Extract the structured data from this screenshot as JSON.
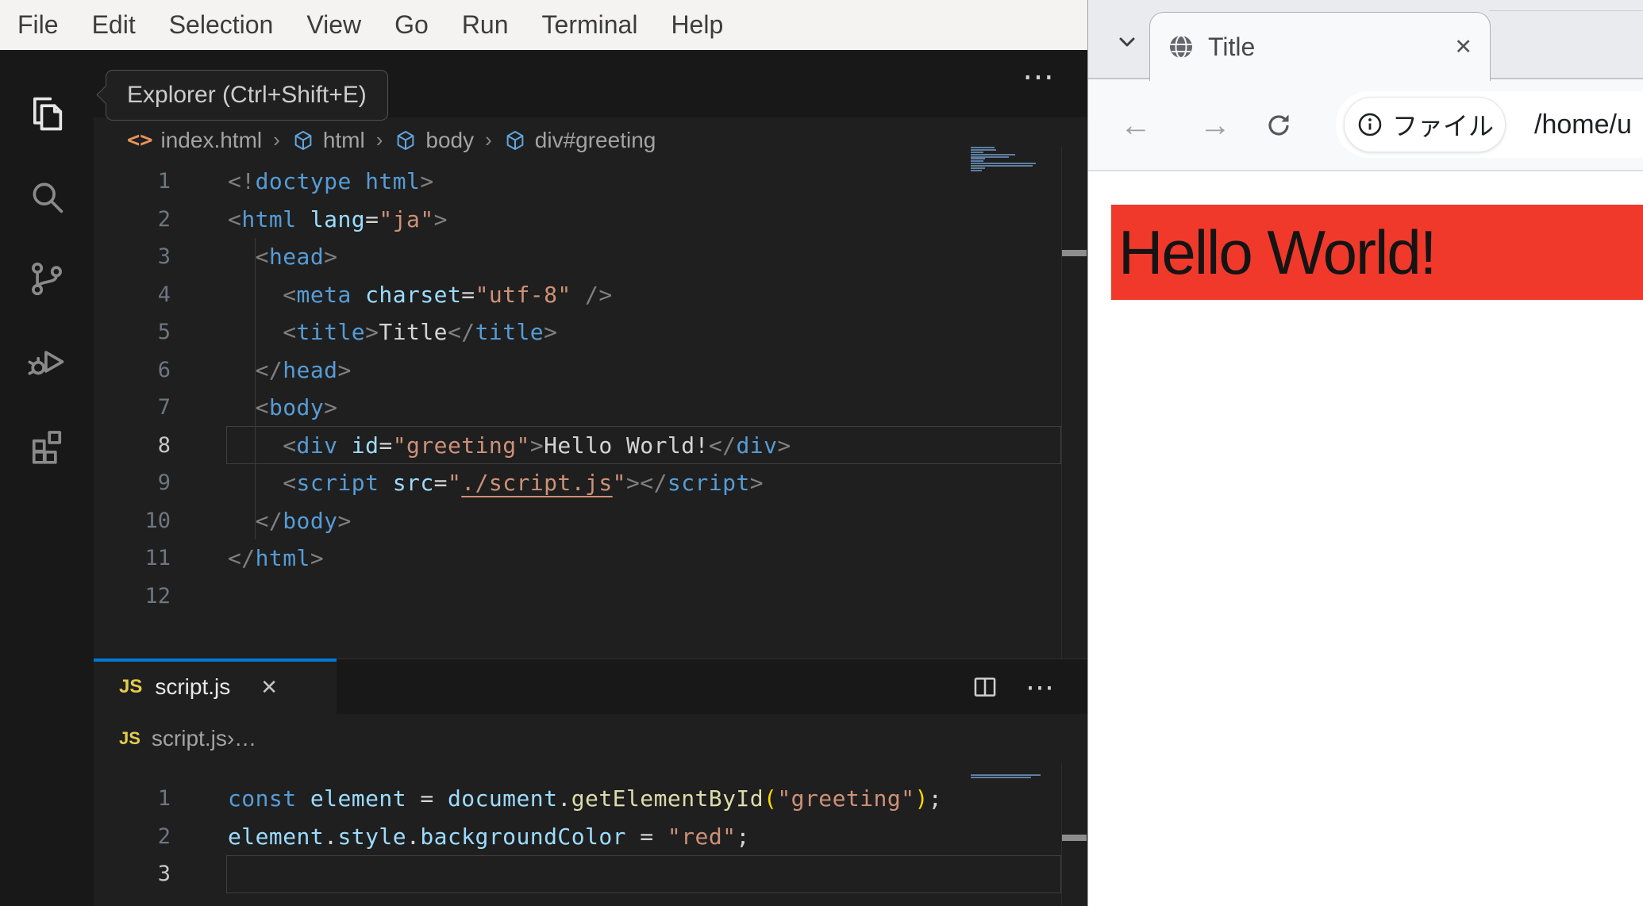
{
  "vscode": {
    "menu": {
      "items": [
        "File",
        "Edit",
        "Selection",
        "View",
        "Go",
        "Run",
        "Terminal",
        "Help"
      ]
    },
    "activity_bar": {
      "tooltip": "Explorer (Ctrl+Shift+E)",
      "icons": [
        "explorer",
        "search",
        "source-control",
        "run-and-debug",
        "extensions"
      ],
      "active_icon": "explorer"
    },
    "html_editor": {
      "overflow_icon": "⋯",
      "breadcrumb": [
        {
          "icon": "code-tag",
          "label": "index.html"
        },
        {
          "icon": "symbol-element",
          "label": "html"
        },
        {
          "icon": "symbol-element",
          "label": "body"
        },
        {
          "icon": "symbol-element",
          "label": "div#greeting"
        }
      ],
      "active_line": 8,
      "lines": [
        [
          [
            "p",
            "<!"
          ],
          [
            "t",
            "doctype html"
          ],
          [
            "p",
            ">"
          ]
        ],
        [
          [
            "p",
            "<"
          ],
          [
            "t",
            "html"
          ],
          [
            "o",
            " "
          ],
          [
            "a",
            "lang"
          ],
          [
            "o",
            "="
          ],
          [
            "s",
            "\"ja\""
          ],
          [
            "p",
            ">"
          ]
        ],
        [
          [
            "o",
            "  "
          ],
          [
            "p",
            "<"
          ],
          [
            "t",
            "head"
          ],
          [
            "p",
            ">"
          ]
        ],
        [
          [
            "o",
            "    "
          ],
          [
            "p",
            "<"
          ],
          [
            "t",
            "meta"
          ],
          [
            "o",
            " "
          ],
          [
            "a",
            "charset"
          ],
          [
            "o",
            "="
          ],
          [
            "s",
            "\"utf-8\""
          ],
          [
            "o",
            " "
          ],
          [
            "p",
            "/>"
          ]
        ],
        [
          [
            "o",
            "    "
          ],
          [
            "p",
            "<"
          ],
          [
            "t",
            "title"
          ],
          [
            "p",
            ">"
          ],
          [
            "w",
            "Title"
          ],
          [
            "p",
            "</"
          ],
          [
            "t",
            "title"
          ],
          [
            "p",
            ">"
          ]
        ],
        [
          [
            "o",
            "  "
          ],
          [
            "p",
            "</"
          ],
          [
            "t",
            "head"
          ],
          [
            "p",
            ">"
          ]
        ],
        [
          [
            "o",
            "  "
          ],
          [
            "p",
            "<"
          ],
          [
            "t",
            "body"
          ],
          [
            "p",
            ">"
          ]
        ],
        [
          [
            "o",
            "    "
          ],
          [
            "p",
            "<"
          ],
          [
            "t",
            "div"
          ],
          [
            "o",
            " "
          ],
          [
            "a",
            "id"
          ],
          [
            "o",
            "="
          ],
          [
            "s",
            "\"greeting\""
          ],
          [
            "p",
            ">"
          ],
          [
            "w",
            "Hello World!"
          ],
          [
            "p",
            "</"
          ],
          [
            "t",
            "div"
          ],
          [
            "p",
            ">"
          ]
        ],
        [
          [
            "o",
            "    "
          ],
          [
            "p",
            "<"
          ],
          [
            "t",
            "script"
          ],
          [
            "o",
            " "
          ],
          [
            "a",
            "src"
          ],
          [
            "o",
            "="
          ],
          [
            "s",
            "\""
          ],
          [
            "link",
            "./script.js"
          ],
          [
            "s",
            "\""
          ],
          [
            "p",
            ">"
          ],
          [
            "p",
            "</"
          ],
          [
            "t",
            "script"
          ],
          [
            "p",
            ">"
          ]
        ],
        [
          [
            "o",
            "  "
          ],
          [
            "p",
            "</"
          ],
          [
            "t",
            "body"
          ],
          [
            "p",
            ">"
          ]
        ],
        [
          [
            "p",
            "</"
          ],
          [
            "t",
            "html"
          ],
          [
            "p",
            ">"
          ]
        ],
        []
      ]
    },
    "js_editor": {
      "tab": {
        "label": "script.js",
        "close_icon": "✕",
        "language_badge": "JS"
      },
      "actions": {
        "split_icon": "split-editor",
        "more_icon": "⋯"
      },
      "breadcrumb_label": "script.js",
      "breadcrumb_overflow": "…",
      "active_line": 3,
      "lines": [
        [
          [
            "k",
            "const"
          ],
          [
            "o",
            " "
          ],
          [
            "v",
            "element"
          ],
          [
            "o",
            " = "
          ],
          [
            "v",
            "document"
          ],
          [
            "o",
            "."
          ],
          [
            "f",
            "getElementById"
          ],
          [
            "b",
            "("
          ],
          [
            "s",
            "\"greeting\""
          ],
          [
            "b",
            ")"
          ],
          [
            "o",
            ";"
          ]
        ],
        [
          [
            "v",
            "element"
          ],
          [
            "o",
            "."
          ],
          [
            "v",
            "style"
          ],
          [
            "o",
            "."
          ],
          [
            "v",
            "backgroundColor"
          ],
          [
            "o",
            " = "
          ],
          [
            "s",
            "\"red\""
          ],
          [
            "o",
            ";"
          ]
        ],
        []
      ]
    }
  },
  "browser": {
    "tab": {
      "title": "Title",
      "close_icon": "✕"
    },
    "toolbar": {
      "url_chip_label": "ファイル",
      "url_path": "/home/u"
    },
    "page": {
      "heading": "Hello World!",
      "heading_bg": "#f0392b"
    }
  },
  "colors": {
    "accent_blue": "#0078d4",
    "menu_bg": "#f4f3f2",
    "editor_bg": "#1f1f1f",
    "panel_bg": "#181818",
    "red_banner": "#f0392b"
  }
}
